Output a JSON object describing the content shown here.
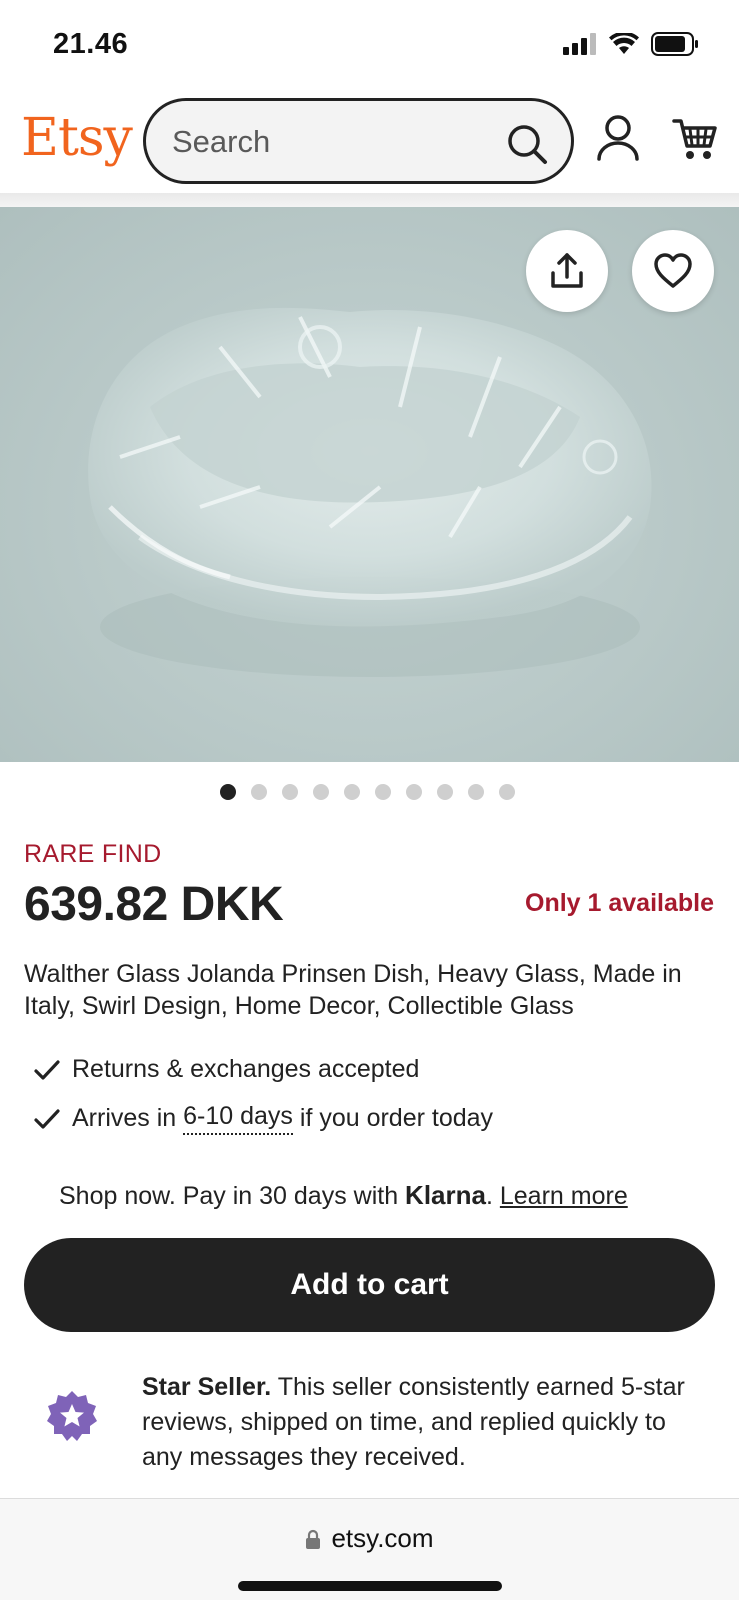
{
  "status_bar": {
    "time": "21.46"
  },
  "header": {
    "logo": "Etsy",
    "search_placeholder": "Search"
  },
  "listing": {
    "badge": "RARE FIND",
    "price": "639.82 DKK",
    "availability": "Only 1 available",
    "title": "Walther Glass Jolanda Prinsen Dish, Heavy Glass, Made in Italy, Swirl Design, Home Decor, Collectible Glass",
    "image_count": 10,
    "current_image": 1
  },
  "benefits": {
    "returns": "Returns & exchanges accepted",
    "arrives_prefix": "Arrives in ",
    "arrives_days": "6-10 days",
    "arrives_suffix": " if you order today"
  },
  "klarna": {
    "prefix": "Shop now. Pay in 30 days with ",
    "brand": "Klarna",
    "suffix": ". ",
    "learn_more": "Learn more"
  },
  "cta": {
    "add_to_cart": "Add to cart"
  },
  "star_seller": {
    "label": "Star Seller.",
    "text": " This seller consistently earned 5-star reviews, shipped on time, and replied quickly to any messages they received."
  },
  "browser": {
    "url": "etsy.com"
  },
  "colors": {
    "brand_orange": "#F1641E",
    "rare_red": "#A61A2E",
    "button_dark": "#222222",
    "star_purple": "#7F63B8"
  }
}
